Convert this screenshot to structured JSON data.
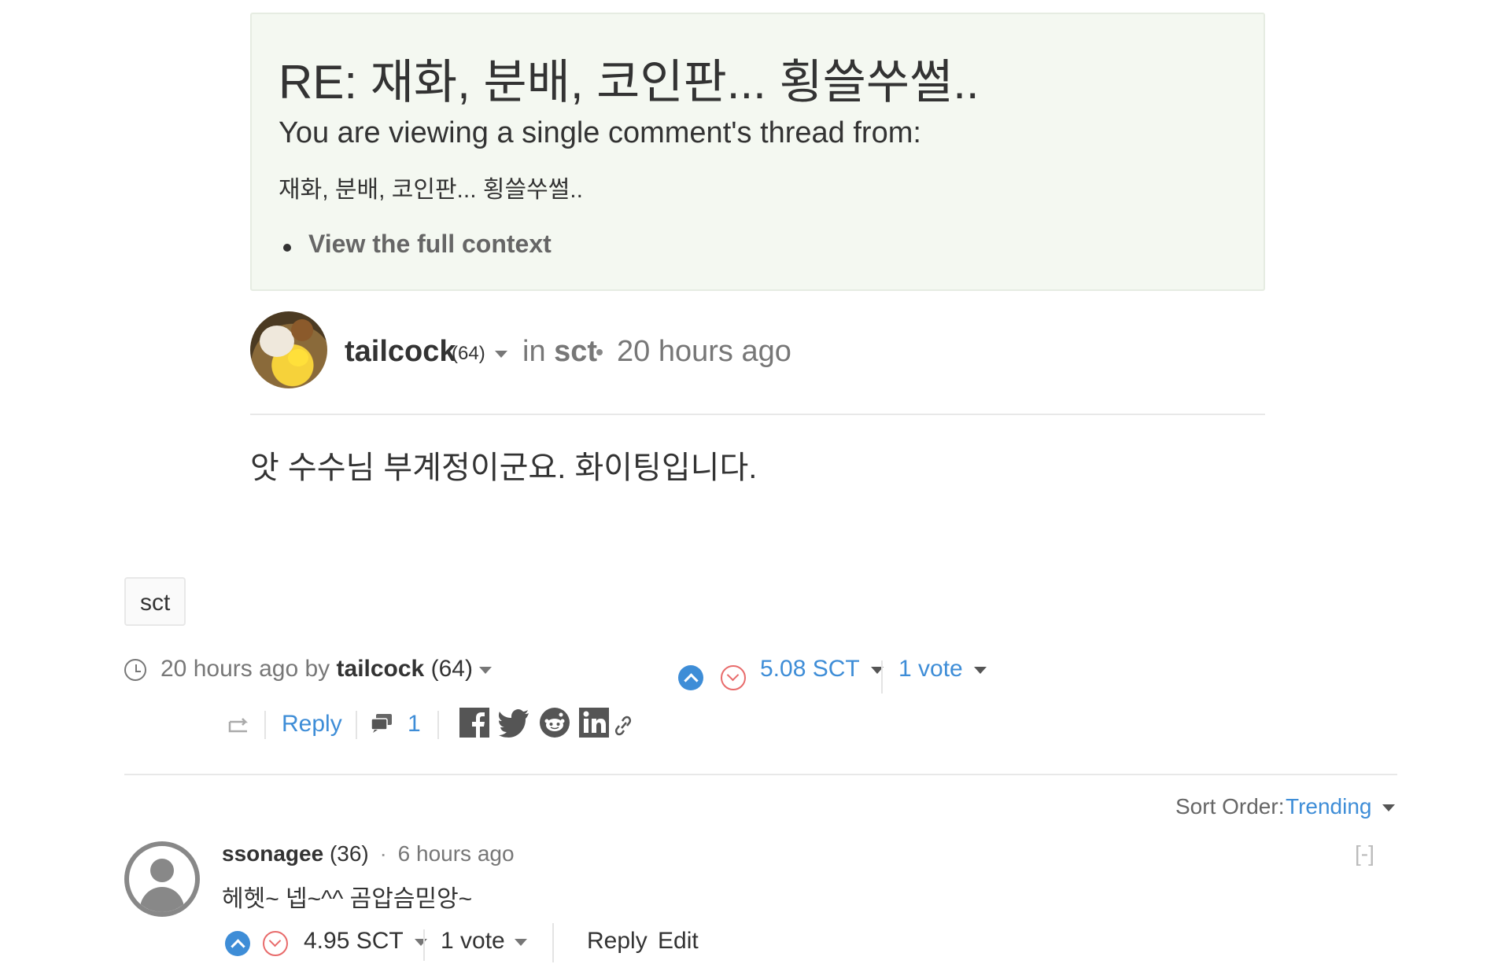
{
  "context": {
    "title": "RE: 재화, 분배, 코인판... 횡쓸쑤썰..",
    "subtitle": "You are viewing a single comment's thread from:",
    "parent_title": "재화, 분배, 코인판... 횡쓸쑤썰..",
    "full_context_link": "View the full context"
  },
  "post": {
    "author": "tailcock",
    "author_rep": "(64)",
    "in_label": "in",
    "category": "sct",
    "time": "20 hours ago",
    "body": "앗 수수님 부계정이군요. 화이팅입니다.",
    "tag": "sct"
  },
  "meta": {
    "time": "20 hours ago",
    "by": "by",
    "author": "tailcock",
    "author_rep": "(64)",
    "payout": "5.08 SCT",
    "votes": "1 vote",
    "reply_label": "Reply",
    "comment_count": "1"
  },
  "sort": {
    "label": "Sort Order:",
    "value": "Trending"
  },
  "reply_comment": {
    "author": "ssonagee",
    "author_rep": "(36)",
    "time": "6 hours ago",
    "collapse": "[-]",
    "body": "헤헷~ 넵~^^ 곰압슴믿앙~",
    "payout": "4.95 SCT",
    "votes": "1 vote",
    "reply_label": "Reply",
    "edit_label": "Edit"
  },
  "colors": {
    "accent": "#3e8dd7",
    "downvote": "#e86b6b",
    "context_bg": "#f4f8f1"
  }
}
